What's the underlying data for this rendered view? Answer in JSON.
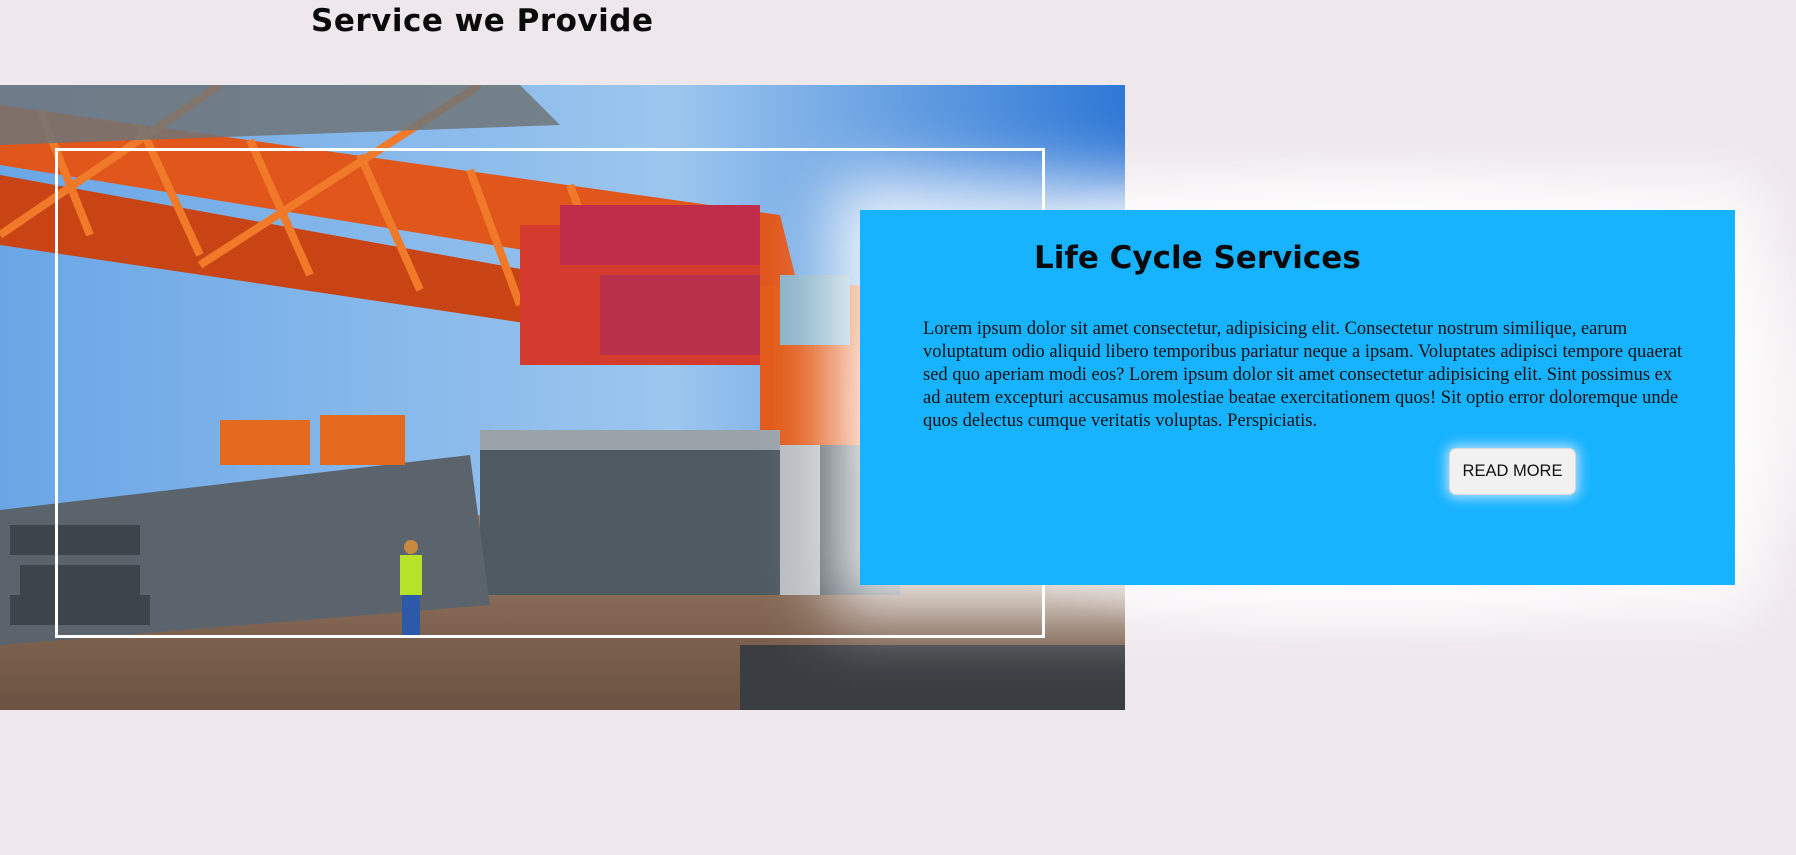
{
  "section": {
    "title": "Service we Provide"
  },
  "hero": {
    "image_alt": "Large orange crawler crane at a construction site",
    "icon": "crane-photo"
  },
  "card": {
    "title": "Life Cycle Services",
    "body": "Lorem ipsum dolor sit amet consectetur, adipisicing elit. Consectetur nostrum similique, earum voluptatum odio aliquid libero temporibus pariatur neque a ipsam. Voluptates adipisci tempore quaerat sed quo aperiam modi eos? Lorem ipsum dolor sit amet consectetur adipisicing elit. Sint possimus ex ad autem excepturi accusamus molestiae beatae exercitationem quos! Sit optio error doloremque unde quos delectus cumque veritatis voluptas. Perspiciatis.",
    "button_label": "READ MORE"
  },
  "colors": {
    "background": "#eee7ec",
    "card": "#17b3ff",
    "button": "#f1f1f1"
  }
}
